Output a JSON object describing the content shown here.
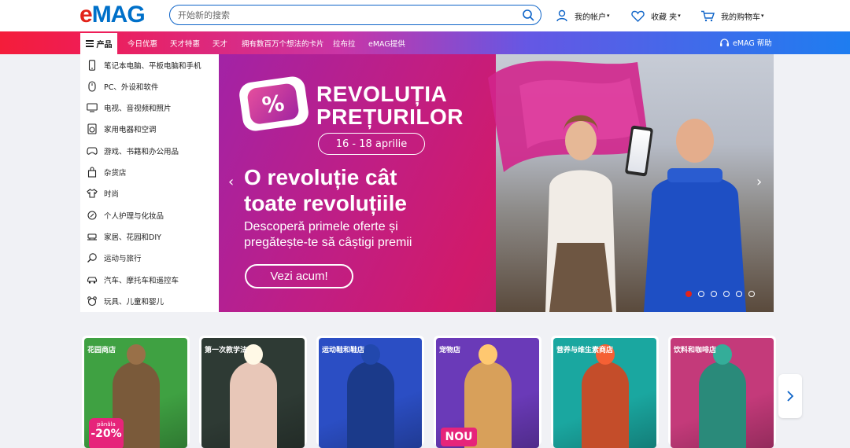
{
  "header": {
    "logo": {
      "part1": "e",
      "part2": "MAG"
    },
    "search": {
      "placeholder": "开始新的搜索"
    },
    "account": "我的帐户",
    "favorites": "收藏 夹",
    "cart": "我的购物车",
    "caret": "▾"
  },
  "navbar": {
    "products": "产品",
    "links": [
      "今日优惠",
      "天才特惠",
      "天才",
      "拥有数百万个想法的卡片",
      "拉布拉",
      "eMAG提供"
    ],
    "help": "eMAG 帮助"
  },
  "menu": {
    "items": [
      {
        "label": "笔记本电脑、平板电脑和手机",
        "icon": "phone-icon"
      },
      {
        "label": "PC、外设和软件",
        "icon": "mouse-icon"
      },
      {
        "label": "电视、音视频和照片",
        "icon": "tv-icon"
      },
      {
        "label": "家用电器和空调",
        "icon": "washing-machine-icon"
      },
      {
        "label": "游戏、书籍和办公用品",
        "icon": "gamepad-icon"
      },
      {
        "label": "杂货店",
        "icon": "shopping-bag-icon"
      },
      {
        "label": "时尚",
        "icon": "tshirt-icon"
      },
      {
        "label": "个人护理与化妆品",
        "icon": "cosmetics-icon"
      },
      {
        "label": "家居、花园和DIY",
        "icon": "home-icon"
      },
      {
        "label": "运动与旅行",
        "icon": "sport-icon"
      },
      {
        "label": "汽车、摩托车和遥控车",
        "icon": "car-icon"
      },
      {
        "label": "玩具、儿童和婴儿",
        "icon": "toy-icon"
      }
    ]
  },
  "hero": {
    "badge": "%",
    "title_line1": "REVOLUȚIA",
    "title_line2": "PREȚURILOR",
    "date": "16 - 18 aprilie",
    "headline_line1": "O revoluție cât",
    "headline_line2": "toate revoluțiile",
    "sub_line1": "Descoperă primele oferte și",
    "sub_line2": "pregătește-te să câștigi premii",
    "cta": "Vezi acum!",
    "slides_total": 6,
    "slide_active": 1
  },
  "cards": [
    {
      "title": "花园商店",
      "bg": "#3fa142",
      "fig": "#7a5a3a",
      "promo": {
        "small": "pânăla",
        "big": "-20%"
      }
    },
    {
      "title": "第一次教学法",
      "bg": "#2e3a34",
      "fig": "#e8c7b8"
    },
    {
      "title": "运动鞋和鞋店",
      "bg": "#2b4ec4",
      "fig": "#1b3a8a"
    },
    {
      "title": "宠物店",
      "bg": "#6a3ab8",
      "fig": "#d8a05a",
      "badge": "NOU"
    },
    {
      "title": "营养与维生素商店",
      "bg": "#1aa7a0",
      "fig": "#c44d2a"
    },
    {
      "title": "饮料和咖啡店",
      "bg": "#c43a7a",
      "fig": "#2a8a7a"
    }
  ],
  "colors": {
    "brand_red": "#e2231a",
    "brand_blue": "#0070c9",
    "search_border": "#0e64c8"
  }
}
